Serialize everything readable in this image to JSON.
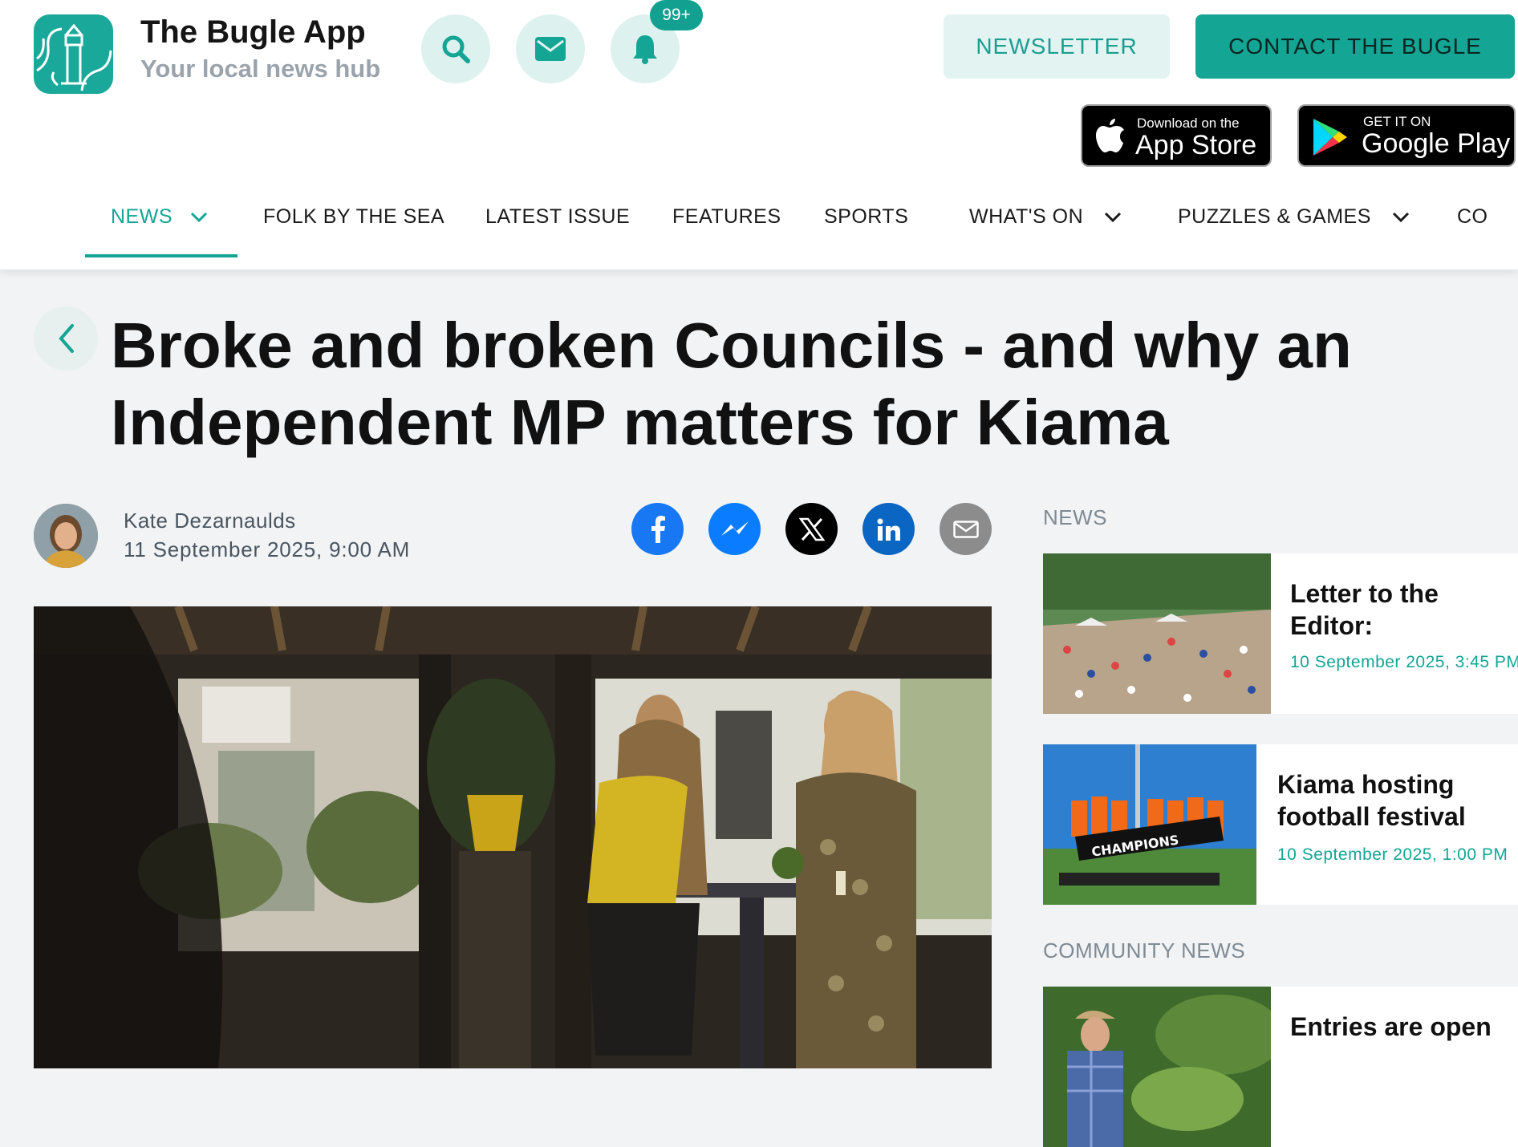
{
  "header": {
    "title": "The Bugle App",
    "subtitle": "Your local news hub",
    "notification_count": "99+",
    "newsletter_label": "NEWSLETTER",
    "contact_label": "CONTACT THE BUGLE",
    "app_store": {
      "small": "Download on the",
      "big": "App Store"
    },
    "google_play": {
      "small": "GET IT ON",
      "big": "Google Play"
    }
  },
  "nav": {
    "items": [
      {
        "label": "NEWS",
        "dropdown": true,
        "active": true
      },
      {
        "label": "FOLK BY THE SEA",
        "dropdown": false
      },
      {
        "label": "LATEST ISSUE",
        "dropdown": false
      },
      {
        "label": "FEATURES",
        "dropdown": false
      },
      {
        "label": "SPORTS",
        "dropdown": false
      },
      {
        "label": "WHAT'S ON",
        "dropdown": true
      },
      {
        "label": "PUZZLES & GAMES",
        "dropdown": true
      },
      {
        "label": "CO",
        "dropdown": false
      }
    ]
  },
  "article": {
    "headline": "Broke and broken Councils - and why an Independent MP matters for Kiama",
    "author": "Kate Dezarnaulds",
    "date": "11 September 2025, 9:00 AM",
    "share": [
      "facebook-icon",
      "messenger-icon",
      "x-icon",
      "linkedin-icon",
      "email-icon"
    ]
  },
  "sidebar": {
    "news_label": "NEWS",
    "news": [
      {
        "title": "Letter to the Editor:",
        "date": "10 September 2025, 3:45 PM"
      },
      {
        "title": "Kiama hosting football festival",
        "date": "10 September 2025, 1:00 PM"
      }
    ],
    "community_label": "COMMUNITY NEWS",
    "community": [
      {
        "title": "Entries are open",
        "date": ""
      }
    ]
  },
  "colors": {
    "accent": "#14a595",
    "accent_light": "#e2f3f1",
    "facebook": "#1877f2",
    "messenger": "#0a7cff",
    "linkedin": "#0a66c2"
  }
}
